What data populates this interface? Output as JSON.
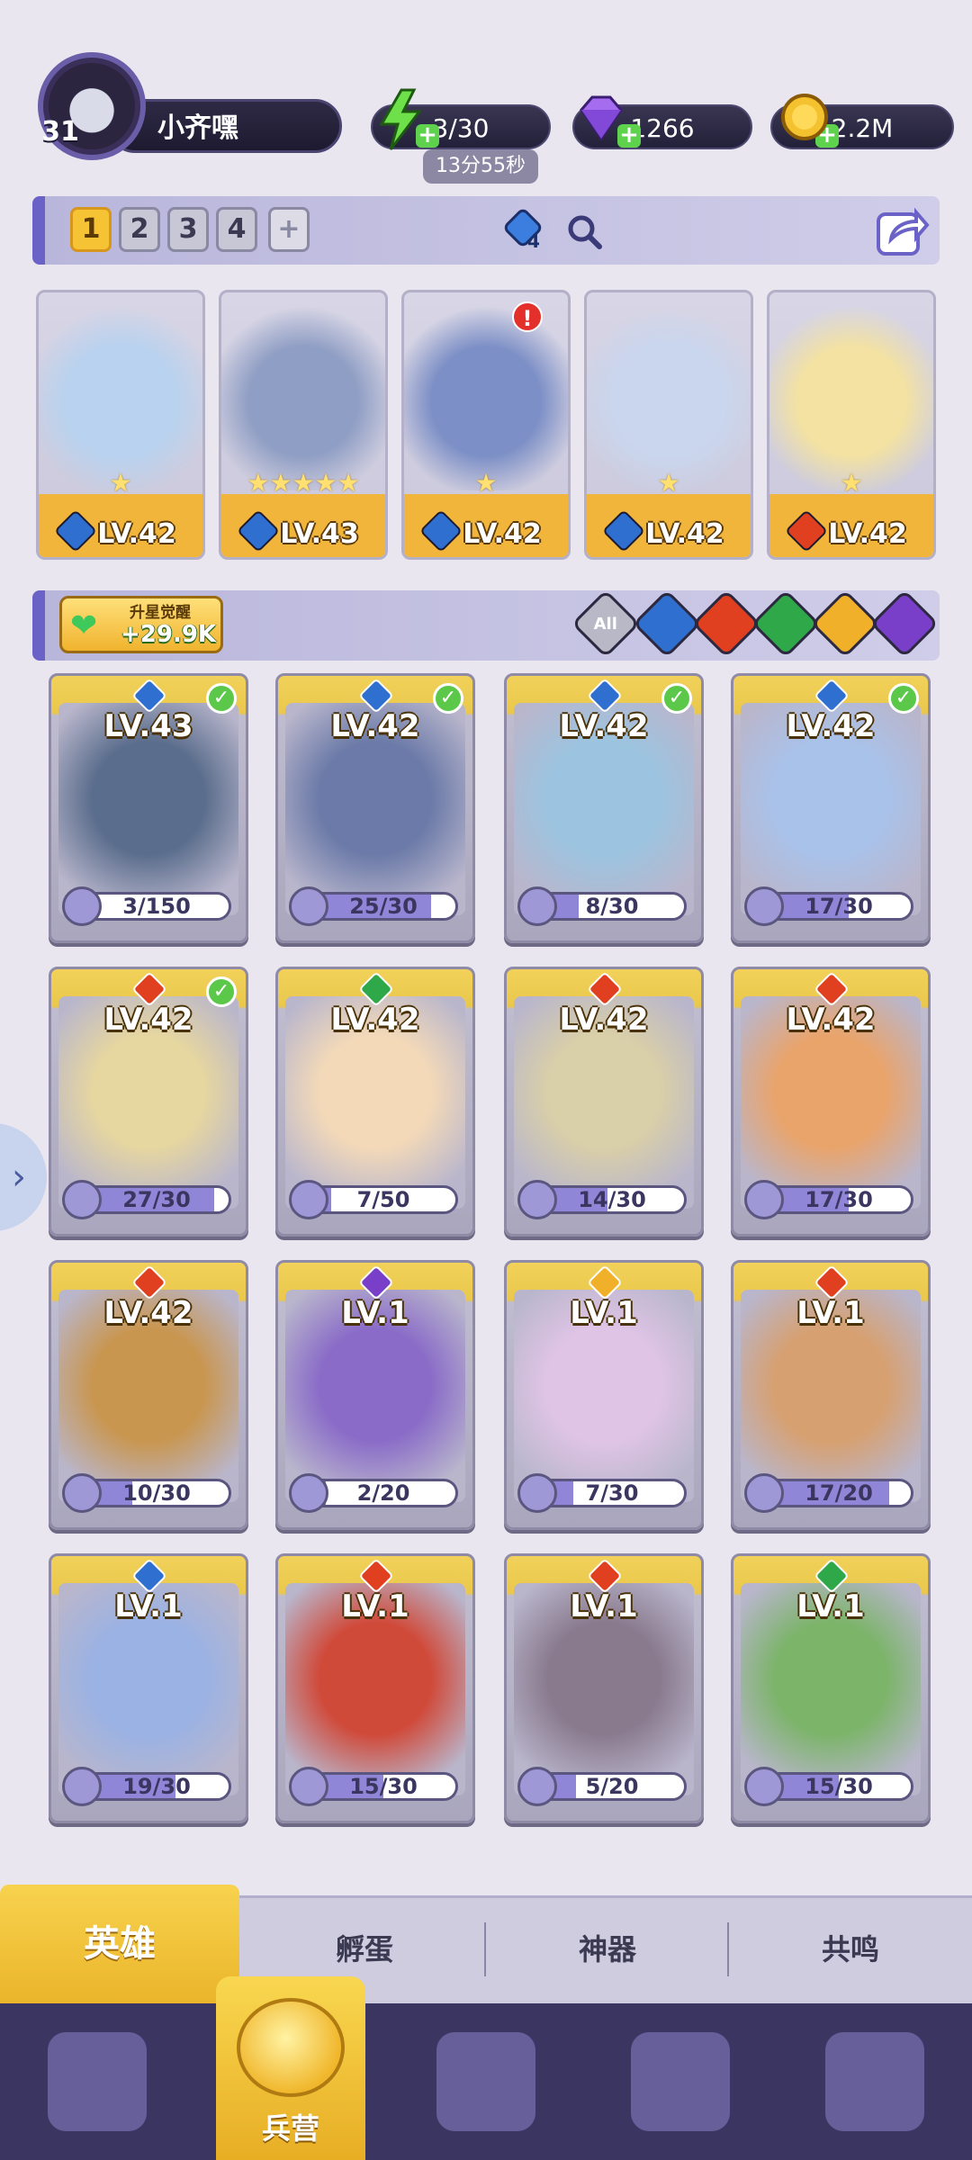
{
  "player": {
    "level": "31",
    "name": "小齐嘿"
  },
  "resources": {
    "energy": "3/30",
    "energy_timer": "13分55秒",
    "gems": "1266",
    "coins": "2.2M"
  },
  "team_tabs": [
    "1",
    "2",
    "3",
    "4",
    "+"
  ],
  "team_badge": "4",
  "lineup": [
    {
      "level": "LV.42",
      "element": "water",
      "stars": "★"
    },
    {
      "level": "LV.43",
      "element": "water",
      "stars": "★★★★★"
    },
    {
      "level": "LV.42",
      "element": "water",
      "stars": "★",
      "alert": "!"
    },
    {
      "level": "LV.42",
      "element": "water",
      "stars": "★"
    },
    {
      "level": "LV.42",
      "element": "fire",
      "stars": "★"
    }
  ],
  "awaken": {
    "label": "升星觉醒",
    "value": "+29.9K"
  },
  "filters": [
    "All",
    "water",
    "fire",
    "wind",
    "light",
    "dark"
  ],
  "heroes": [
    {
      "level": "LV.43",
      "element": "water",
      "shards": "3/150",
      "fill": 0.02,
      "check": true
    },
    {
      "level": "LV.42",
      "element": "water",
      "shards": "25/30",
      "fill": 0.83,
      "check": true
    },
    {
      "level": "LV.42",
      "element": "water",
      "shards": "8/30",
      "fill": 0.27,
      "check": true
    },
    {
      "level": "LV.42",
      "element": "water",
      "shards": "17/30",
      "fill": 0.57,
      "check": true
    },
    {
      "level": "LV.42",
      "element": "fire",
      "shards": "27/30",
      "fill": 0.9,
      "check": true
    },
    {
      "level": "LV.42",
      "element": "wind",
      "shards": "7/50",
      "fill": 0.14,
      "check": false
    },
    {
      "level": "LV.42",
      "element": "fire",
      "shards": "14/30",
      "fill": 0.47,
      "check": false
    },
    {
      "level": "LV.42",
      "element": "fire",
      "shards": "17/30",
      "fill": 0.57,
      "check": false
    },
    {
      "level": "LV.42",
      "element": "fire",
      "shards": "10/30",
      "fill": 0.33,
      "check": false
    },
    {
      "level": "LV.1",
      "element": "dark",
      "shards": "2/20",
      "fill": 0.1,
      "check": false
    },
    {
      "level": "LV.1",
      "element": "light",
      "shards": "7/30",
      "fill": 0.23,
      "check": false
    },
    {
      "level": "LV.1",
      "element": "fire",
      "shards": "17/20",
      "fill": 0.85,
      "check": false
    },
    {
      "level": "LV.1",
      "element": "water",
      "shards": "19/30",
      "fill": 0.63,
      "check": false
    },
    {
      "level": "LV.1",
      "element": "fire",
      "shards": "15/30",
      "fill": 0.5,
      "check": false
    },
    {
      "level": "LV.1",
      "element": "fire",
      "shards": "5/20",
      "fill": 0.25,
      "check": false
    },
    {
      "level": "LV.1",
      "element": "wind",
      "shards": "15/30",
      "fill": 0.5,
      "check": false
    }
  ],
  "colors": {
    "water": "#2f6fd0",
    "fire": "#e0401f",
    "wind": "#2fa84a",
    "light": "#f0b02a",
    "dark": "#7a3fc8",
    "all": "#b9b8c6"
  },
  "sub_tabs": [
    "英雄",
    "孵蛋",
    "神器",
    "共鸣"
  ],
  "nav": {
    "active_label": "兵营"
  },
  "side_arrow": "›"
}
